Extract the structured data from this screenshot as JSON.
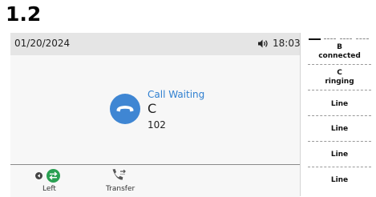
{
  "heading": "1.2",
  "status_bar": {
    "date": "01/20/2024",
    "time": "18:03",
    "volume_icon": "speaker-volume-icon"
  },
  "call": {
    "status": "Call Waiting",
    "name": "C",
    "number": "102",
    "avatar_icon": "handset-hangup-icon",
    "avatar_color": "#3f86d3"
  },
  "softkeys": [
    {
      "label": "Left",
      "icon": "swap-arrows-icon",
      "icon_color": "#2aa052"
    },
    {
      "label": "Transfer",
      "icon": "transfer-phone-icon"
    }
  ],
  "line_keys": [
    {
      "line1": "B",
      "line2": "connected"
    },
    {
      "line1": "C",
      "line2": "ringing"
    },
    {
      "line1": "Line",
      "line2": ""
    },
    {
      "line1": "Line",
      "line2": ""
    },
    {
      "line1": "Line",
      "line2": ""
    },
    {
      "line1": "Line",
      "line2": ""
    }
  ]
}
